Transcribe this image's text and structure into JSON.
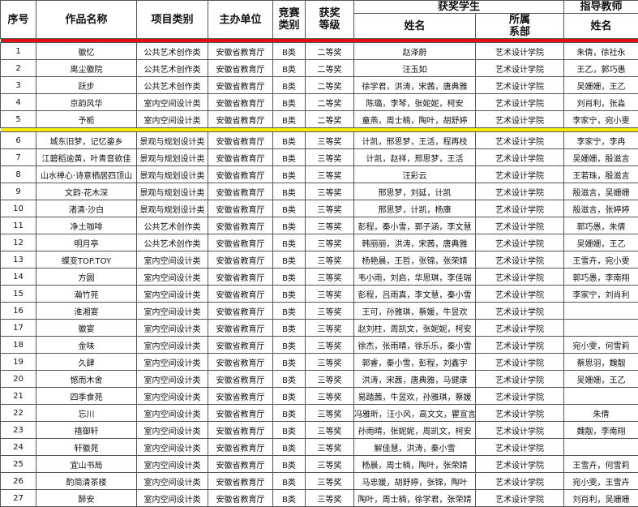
{
  "headers": {
    "seq": "序号",
    "work": "作品名称",
    "category": "项目类别",
    "organizer": "主办单位",
    "competition_class": "竞赛\n类别",
    "award_level": "获奖\n等级",
    "students": "获奖学生",
    "student_name": "姓名",
    "department": "所属\n系部",
    "teachers": "指导教师",
    "teacher_name": "姓名"
  },
  "separator_colors": {
    "red": "#e30f14",
    "yellow": "#f7e806"
  },
  "rows_second": [
    {
      "no": "1",
      "work": "徽忆",
      "cat": "公共艺术创作类",
      "org": "安徽省教育厅",
      "cls": "B类",
      "lvl": "二等奖",
      "stu": "赵泽蔚",
      "dept": "艺术设计学院",
      "tch": "朱倩，徐社永"
    },
    {
      "no": "2",
      "work": "离尘徽院",
      "cat": "公共艺术创作类",
      "org": "安徽省教育厅",
      "cls": "B类",
      "lvl": "二等奖",
      "stu": "汪玉如",
      "dept": "艺术设计学院",
      "tch": "王乙，郭巧愚"
    },
    {
      "no": "3",
      "work": "跃步",
      "cat": "公共艺术创作类",
      "org": "安徽省教育厅",
      "cls": "B类",
      "lvl": "二等奖",
      "stu": "徐学君，洪涛，宋茜，唐典雅",
      "dept": "艺术设计学院",
      "tch": "吴姗姗，王乙"
    },
    {
      "no": "4",
      "work": "京韵风华",
      "cat": "室内空间设计类",
      "org": "安徽省教育厅",
      "cls": "B类",
      "lvl": "二等奖",
      "stu": "陈璐，李琴，张妮妮，柯安",
      "dept": "艺术设计学院",
      "tch": "刘肖利，张淼"
    },
    {
      "no": "5",
      "work": "予栀",
      "cat": "室内空间设计类",
      "org": "安徽省教育厅",
      "cls": "B类",
      "lvl": "二等奖",
      "stu": "童燕，周士楠，陶叶，胡舒婷",
      "dept": "艺术设计学院",
      "tch": "李家宁，宛小雯"
    }
  ],
  "rows_third": [
    {
      "no": "6",
      "work": "城东旧梦，记忆鎏乡",
      "cat": "景观与规划设计类",
      "org": "安徽省教育厅",
      "cls": "B类",
      "lvl": "三等奖",
      "stu": "计凯，邢思梦，王活，程再枝",
      "dept": "艺术设计学院",
      "tch": "李家宁，李冉"
    },
    {
      "no": "7",
      "work": "江碧稻逾黄，叶青音欲佳",
      "cat": "景观与规划设计类",
      "org": "安徽省教育厅",
      "cls": "B类",
      "lvl": "三等奖",
      "stu": "计凯，赵祥，邢思梦，王活",
      "dept": "艺术设计学院",
      "tch": "吴姗姗，殷滋言"
    },
    {
      "no": "8",
      "work": "山水禅心·诗意栖居四顶山",
      "cat": "景观与规划设计类",
      "org": "安徽省教育厅",
      "cls": "B类",
      "lvl": "三等奖",
      "stu": "汪彩云",
      "dept": "艺术设计学院",
      "tch": "王若珠，殷滋言"
    },
    {
      "no": "9",
      "work": "文韵·花木深",
      "cat": "景观与规划设计类",
      "org": "安徽省教育厅",
      "cls": "B类",
      "lvl": "三等奖",
      "stu": "邢思梦，刘延，计凯",
      "dept": "艺术设计学院",
      "tch": "殷滋言，吴姗姗"
    },
    {
      "no": "10",
      "work": "渚清·沙白",
      "cat": "景观与规划设计类",
      "org": "安徽省教育厅",
      "cls": "B类",
      "lvl": "三等奖",
      "stu": "邢思梦，计凯，杨康",
      "dept": "艺术设计学院",
      "tch": "殷滋言，张婷婷"
    },
    {
      "no": "11",
      "work": "净土咖啡",
      "cat": "公共艺术创作类",
      "org": "安徽省教育厅",
      "cls": "B类",
      "lvl": "三等奖",
      "stu": "彭程，秦小雪，郭子涵，李文慧",
      "dept": "艺术设计学院",
      "tch": "郭巧愚，朱倩"
    },
    {
      "no": "12",
      "work": "明月亭",
      "cat": "公共艺术创作类",
      "org": "安徽省教育厅",
      "cls": "B类",
      "lvl": "三等奖",
      "stu": "韩丽丽，洪涛，宋茜，唐典雅",
      "dept": "艺术设计学院",
      "tch": "吴姗姗，王乙"
    },
    {
      "no": "13",
      "work": "蝶变TOP.TOY",
      "cat": "室内空间设计类",
      "org": "安徽省教育厅",
      "cls": "B类",
      "lvl": "三等奖",
      "stu": "杨艳晨，王哲，张锦，张荣婧",
      "dept": "艺术设计学院",
      "tch": "王雪卉，宛小雯"
    },
    {
      "no": "14",
      "work": "方圆",
      "cat": "室内空间设计类",
      "org": "安徽省教育厅",
      "cls": "B类",
      "lvl": "三等奖",
      "stu": "韦小雨，刘启，华思琪，李佳瑞",
      "dept": "艺术设计学院",
      "tch": "郭巧愚，李南翔"
    },
    {
      "no": "15",
      "work": "瀚竹苑",
      "cat": "室内空间设计类",
      "org": "安徽省教育厅",
      "cls": "B类",
      "lvl": "三等奖",
      "stu": "彭程，吕雨真，李文慧，秦小雪",
      "dept": "艺术设计学院",
      "tch": "李家宁，刘肖利"
    },
    {
      "no": "16",
      "work": "淮湘宴",
      "cat": "室内空间设计类",
      "org": "安徽省教育厅",
      "cls": "B类",
      "lvl": "三等奖",
      "stu": "王可，孙雅琪，蔡媛，牛昱欢",
      "dept": "艺术设计学院",
      "tch": ""
    },
    {
      "no": "17",
      "work": "徽宴",
      "cat": "室内空间设计类",
      "org": "安徽省教育厅",
      "cls": "B类",
      "lvl": "三等奖",
      "stu": "赵刘柱，周凯文，张妮妮，柯安",
      "dept": "艺术设计学院",
      "tch": ""
    },
    {
      "no": "18",
      "work": "金味",
      "cat": "室内空间设计类",
      "org": "安徽省教育厅",
      "cls": "B类",
      "lvl": "三等奖",
      "stu": "徐杰，张雨晴，徐乐乐，秦小雪",
      "dept": "艺术设计学院",
      "tch": "宛小雯，何雪莉"
    },
    {
      "no": "19",
      "work": "久肆",
      "cat": "室内空间设计类",
      "org": "安徽省教育厅",
      "cls": "B类",
      "lvl": "三等奖",
      "stu": "郭睿，秦小雪，彭程，刘鑫宇",
      "dept": "艺术设计学院",
      "tch": "蔡思羽，魏靓"
    },
    {
      "no": "20",
      "work": "憾而木舍",
      "cat": "室内空间设计类",
      "org": "安徽省教育厅",
      "cls": "B类",
      "lvl": "三等奖",
      "stu": "洪涛，宋茜，唐典雅，马健康",
      "dept": "艺术设计学院",
      "tch": "吴姗姗，王乙"
    },
    {
      "no": "21",
      "work": "四季食苑",
      "cat": "室内空间设计类",
      "org": "安徽省教育厅",
      "cls": "B类",
      "lvl": "三等奖",
      "stu": "易踏茜，牛昱欢，孙雅琪，蔡媛",
      "dept": "艺术设计学院",
      "tch": ""
    },
    {
      "no": "22",
      "work": "忘川",
      "cat": "室内空间设计类",
      "org": "安徽省教育厅",
      "cls": "B类",
      "lvl": "三等奖",
      "stu": "冯雅昕，汪小风，高文文，瞿宣言",
      "dept": "艺术设计学院",
      "tch": "朱倩"
    },
    {
      "no": "23",
      "work": "禧御轩",
      "cat": "室内空间设计类",
      "org": "安徽省教育厅",
      "cls": "B类",
      "lvl": "三等奖",
      "stu": "孙雨晴，张妮妮，周凯文，柯安",
      "dept": "艺术设计学院",
      "tch": "魏靓，李南翔"
    },
    {
      "no": "24",
      "work": "轩徽苑",
      "cat": "室内空间设计类",
      "org": "安徽省教育厅",
      "cls": "B类",
      "lvl": "三等奖",
      "stu": "解佳慧，洪涛，秦小雪",
      "dept": "艺术设计学院",
      "tch": ""
    },
    {
      "no": "25",
      "work": "宜山书局",
      "cat": "室内空间设计类",
      "org": "安徽省教育厅",
      "cls": "B类",
      "lvl": "三等奖",
      "stu": "杨晨，周士楠，陶叶，张荣婧",
      "dept": "艺术设计学院",
      "tch": "王雪卉，何雪莉"
    },
    {
      "no": "26",
      "work": "酌简清茶楼",
      "cat": "室内空间设计类",
      "org": "安徽省教育厅",
      "cls": "B类",
      "lvl": "三等奖",
      "stu": "马忠媛，胡舒婷，张锦，陶叶",
      "dept": "艺术设计学院",
      "tch": "宛小雯，王雪卉"
    },
    {
      "no": "27",
      "work": "醉安",
      "cat": "室内空间设计类",
      "org": "安徽省教育厅",
      "cls": "B类",
      "lvl": "三等奖",
      "stu": "陶叶，周士楠，徐学君，张荣婧",
      "dept": "艺术设计学院",
      "tch": "刘肖利，吴姗姗"
    }
  ]
}
